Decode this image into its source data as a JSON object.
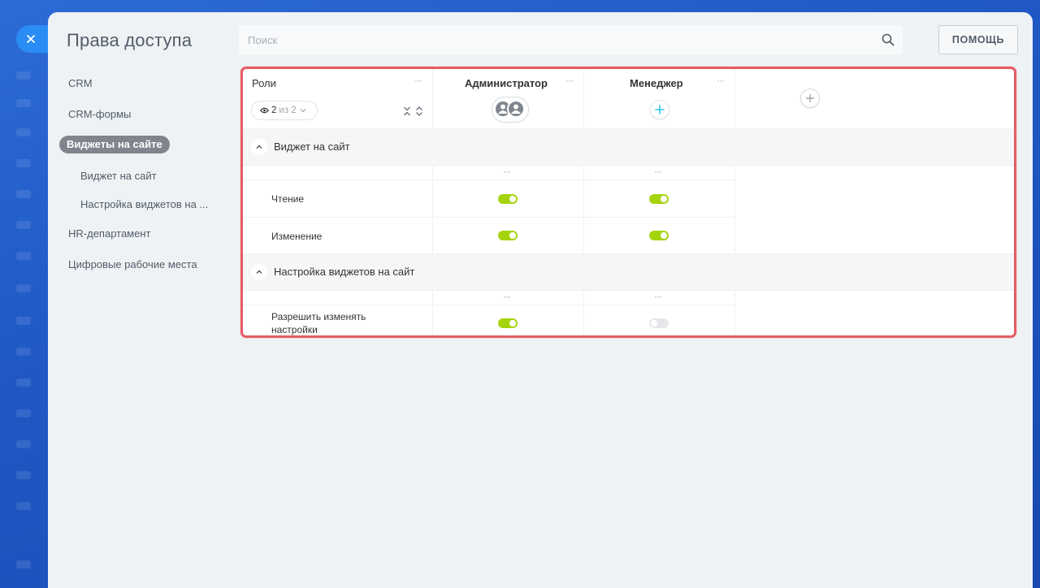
{
  "page": {
    "title": "Права доступа",
    "search_placeholder": "Поиск",
    "help_label": "ПОМОЩЬ"
  },
  "nav": {
    "items": [
      {
        "label": "CRM",
        "active": false,
        "level": 1
      },
      {
        "label": "CRM-формы",
        "active": false,
        "level": 1
      },
      {
        "label": "Виджеты на сайте",
        "active": true,
        "level": 1
      },
      {
        "label": "Виджет на сайт",
        "active": false,
        "level": 2
      },
      {
        "label": "Настройка виджетов на ...",
        "active": false,
        "level": 2
      },
      {
        "label": "HR-департамент",
        "active": false,
        "level": 1
      },
      {
        "label": "Цифровые рабочие места",
        "active": false,
        "level": 1
      }
    ]
  },
  "table": {
    "roles_header": "Роли",
    "filter": {
      "shown": "2",
      "of_label": "из 2"
    },
    "columns": [
      {
        "title": "Администратор",
        "members": "group-avatars"
      },
      {
        "title": "Менеджер",
        "members": "add-member"
      }
    ],
    "sections": [
      {
        "title": "Виджет на сайт",
        "rows": [
          {
            "label": "Чтение",
            "values": [
              true,
              true
            ]
          },
          {
            "label": "Изменение",
            "values": [
              true,
              true
            ]
          }
        ]
      },
      {
        "title": "Настройка виджетов на сайт",
        "rows": [
          {
            "label": "Разрешить изменять настройки",
            "values": [
              true,
              false
            ]
          }
        ]
      }
    ]
  },
  "colors": {
    "accent": "#2a8df5",
    "highlight_border": "#e65c64",
    "switch_on": "#a5d40f",
    "switch_off": "#e5e7ea",
    "active_nav": "#80858d"
  }
}
